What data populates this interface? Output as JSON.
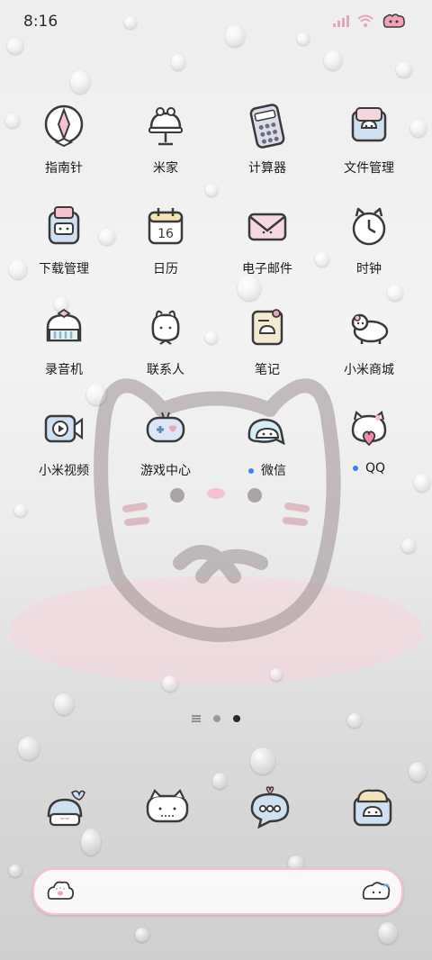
{
  "status_bar": {
    "time": "8:16",
    "icons": [
      "signal-icon",
      "wifi-icon",
      "battery-icon"
    ]
  },
  "apps": [
    {
      "label": "指南针",
      "icon": "compass-icon"
    },
    {
      "label": "米家",
      "icon": "mijia-icon"
    },
    {
      "label": "计算器",
      "icon": "calculator-icon"
    },
    {
      "label": "文件管理",
      "icon": "file-manager-icon"
    },
    {
      "label": "下载管理",
      "icon": "download-icon"
    },
    {
      "label": "日历",
      "icon": "calendar-icon",
      "calendar_day": "16"
    },
    {
      "label": "电子邮件",
      "icon": "email-icon"
    },
    {
      "label": "时钟",
      "icon": "clock-icon"
    },
    {
      "label": "录音机",
      "icon": "recorder-icon"
    },
    {
      "label": "联系人",
      "icon": "contacts-icon"
    },
    {
      "label": "笔记",
      "icon": "notes-icon"
    },
    {
      "label": "小米商城",
      "icon": "mi-store-icon"
    },
    {
      "label": "小米视频",
      "icon": "mi-video-icon"
    },
    {
      "label": "游戏中心",
      "icon": "game-center-icon"
    },
    {
      "label": "微信",
      "icon": "wechat-icon",
      "new_badge": true
    },
    {
      "label": "QQ",
      "icon": "qq-icon",
      "new_badge": true
    }
  ],
  "page_indicator": {
    "total_pages": 2,
    "current_page": 2
  },
  "dock": [
    {
      "icon": "phone-icon"
    },
    {
      "icon": "messages-icon"
    },
    {
      "icon": "chat-icon"
    },
    {
      "icon": "camera-icon"
    }
  ],
  "search_bar": {
    "left_icon": "cloud-search-icon",
    "right_icon": "assistant-icon"
  },
  "colors": {
    "accent_pink": "#f4c2cf",
    "badge_blue": "#3a82f7",
    "icon_outline": "#3a3a3a"
  }
}
